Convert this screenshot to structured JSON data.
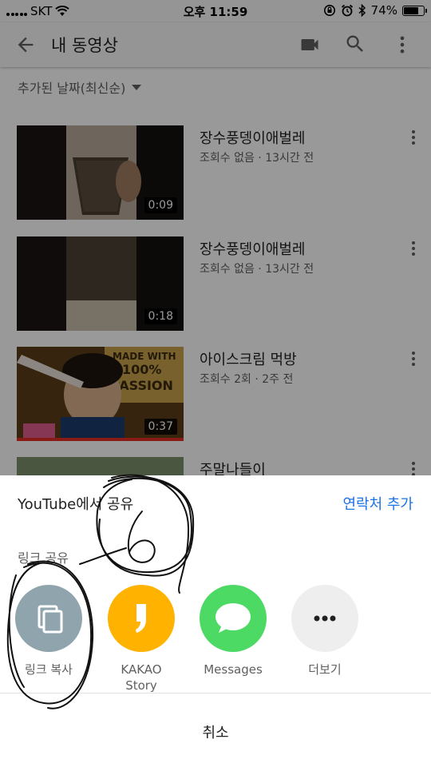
{
  "status_bar": {
    "carrier": "SKT",
    "time": "오후 11:59",
    "battery_percent": "74%",
    "battery_level": 0.74
  },
  "app_bar": {
    "title": "내 동영상",
    "icons": [
      "back-arrow-icon",
      "videocam-icon",
      "search-icon",
      "more-vert-icon"
    ]
  },
  "sort": {
    "label": "추가된 날짜(최신순)"
  },
  "videos": [
    {
      "title": "장수풍뎅이애벌레",
      "meta": "조회수 없음 · 13시간 전",
      "duration": "0:09"
    },
    {
      "title": "장수풍뎅이애벌레",
      "meta": "조회수 없음 · 13시간 전",
      "duration": "0:18"
    },
    {
      "title": "아이스크림 먹방",
      "meta": "조회수 2회 · 2주 전",
      "duration": "0:37",
      "watched_progress": 1.0
    },
    {
      "title": "주말나들이",
      "meta": "",
      "duration": ""
    }
  ],
  "share_sheet": {
    "title": "YouTube에서 공유",
    "add_contact": "연락처 추가",
    "link_share": "링크 공유",
    "options": [
      {
        "label": "링크 복사",
        "icon": "copy-icon",
        "color": "#90a4ae"
      },
      {
        "label": "KAKAO\nStory",
        "icon": "kakaostory-icon",
        "color": "#ffb300"
      },
      {
        "label": "Messages",
        "icon": "messages-icon",
        "color": "#4cd964"
      },
      {
        "label": "더보기",
        "icon": "more-horiz-icon",
        "color": "#eeeeee"
      }
    ],
    "cancel": "취소"
  },
  "colors": {
    "accent_blue": "#1a73e8",
    "progress_red": "#e52d27"
  }
}
